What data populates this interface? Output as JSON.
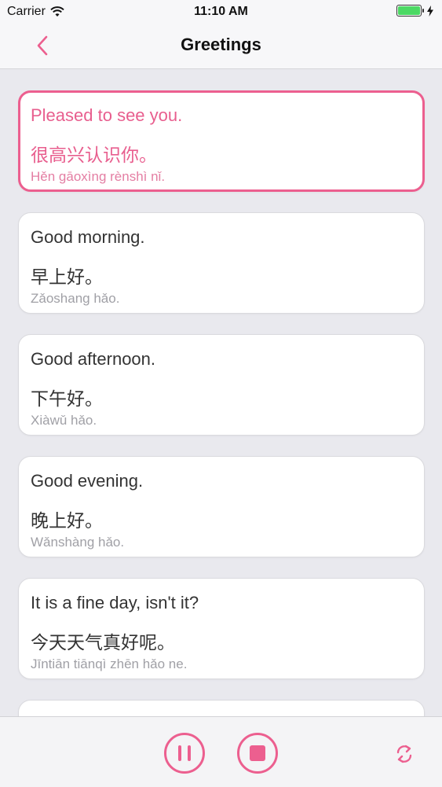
{
  "status": {
    "carrier": "Carrier",
    "time": "11:10 AM",
    "battery_level": 1.0
  },
  "nav": {
    "title": "Greetings"
  },
  "phrases": [
    {
      "english": "Pleased to see you.",
      "chinese": "很高兴认识你。",
      "pinyin": "Hěn gāoxìng rènshì nǐ.",
      "active": true
    },
    {
      "english": "Good morning.",
      "chinese": "早上好。",
      "pinyin": "Zǎoshang hǎo."
    },
    {
      "english": "Good afternoon.",
      "chinese": "下午好。",
      "pinyin": "Xiàwǔ hǎo."
    },
    {
      "english": "Good evening.",
      "chinese": "晚上好。",
      "pinyin": "Wǎnshàng hǎo."
    },
    {
      "english": "It is a fine day, isn't it?",
      "chinese": "今天天气真好呢。",
      "pinyin": "Jīntiān tiānqì zhēn hǎo ne."
    }
  ],
  "toolbar": {
    "pause_icon": "pause-icon",
    "stop_icon": "stop-icon",
    "repeat_icon": "repeat-icon"
  },
  "colors": {
    "accent": "#ec5f8f",
    "background": "#e9e9ee",
    "card": "#ffffff",
    "pinyin_gray": "#a0a0a6",
    "battery_green": "#4cd964"
  }
}
